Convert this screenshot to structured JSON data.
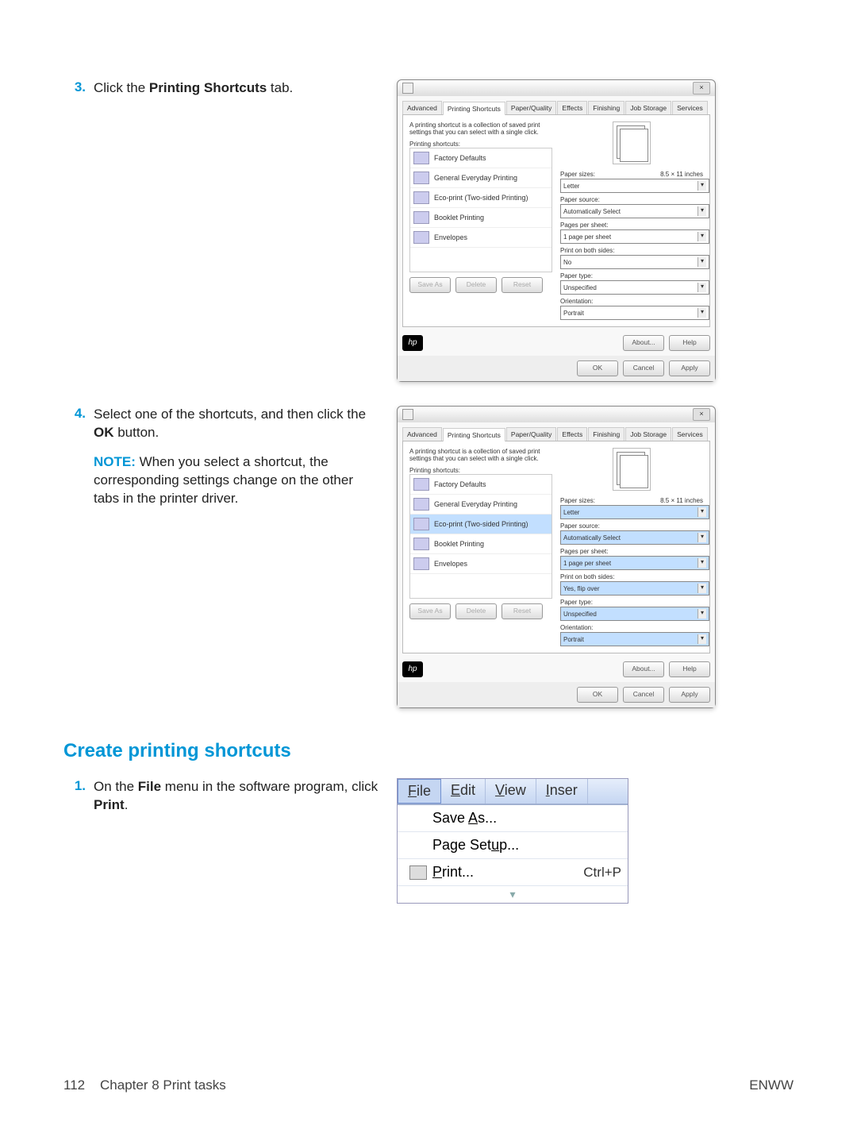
{
  "step3": {
    "number": "3.",
    "text_prefix": "Click the ",
    "text_bold": "Printing Shortcuts",
    "text_suffix": " tab."
  },
  "step4": {
    "number": "4.",
    "text_line1_prefix": "Select one of the shortcuts, and then click the ",
    "text_line1_bold": "OK",
    "text_line1_suffix": " button.",
    "note_label": "NOTE:",
    "note_text": " When you select a shortcut, the corresponding settings change on the other tabs in the printer driver."
  },
  "section2": {
    "heading": "Create printing shortcuts",
    "step1": {
      "number": "1.",
      "prefix": "On the ",
      "bold1": "File",
      "mid": " menu in the software program, click ",
      "bold2": "Print",
      "suffix": "."
    }
  },
  "dialog": {
    "close": "×",
    "tabs": [
      "Advanced",
      "Printing Shortcuts",
      "Paper/Quality",
      "Effects",
      "Finishing",
      "Job Storage",
      "Services"
    ],
    "desc": "A printing shortcut is a collection of saved print settings that you can select with a single click.",
    "list_label": "Printing shortcuts:",
    "shortcuts": [
      "Factory Defaults",
      "General Everyday Printing",
      "Eco-print (Two-sided Printing)",
      "Booklet Printing",
      "Envelopes"
    ],
    "paper_sizes_label": "Paper sizes:",
    "paper_dim": "8.5 × 11 inches",
    "paper_sizes_value": "Letter",
    "paper_source_label": "Paper source:",
    "paper_source_value": "Automatically Select",
    "pages_per_sheet_label": "Pages per sheet:",
    "pages_per_sheet_value": "1 page per sheet",
    "both_sides_label": "Print on both sides:",
    "both_sides_value_a": "No",
    "both_sides_value_b": "Yes, flip over",
    "paper_type_label": "Paper type:",
    "paper_type_value": "Unspecified",
    "orientation_label": "Orientation:",
    "orientation_value": "Portrait",
    "btn_save_as": "Save As",
    "btn_delete": "Delete",
    "btn_reset": "Reset",
    "btn_about": "About...",
    "btn_help": "Help",
    "btn_ok": "OK",
    "btn_cancel": "Cancel",
    "btn_apply": "Apply",
    "logo": "hp",
    "arrow": "▾"
  },
  "filemenu": {
    "items": [
      "File",
      "Edit",
      "View",
      "Inser"
    ],
    "save_as": "Save As...",
    "page_setup": "Page Setup...",
    "print": "Print...",
    "print_shortcut": "Ctrl+P",
    "expand": "▾"
  },
  "footer": {
    "page_num": "112",
    "chapter": "Chapter 8   Print tasks",
    "right": "ENWW"
  }
}
